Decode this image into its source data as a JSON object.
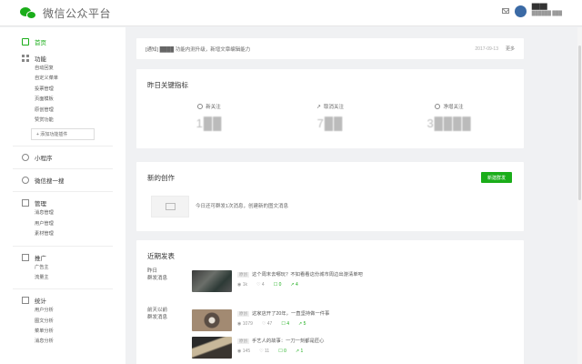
{
  "topbar": {
    "brand": "微信公众平台",
    "user_name": "████",
    "user_sub": "██████ ███"
  },
  "sidebar": {
    "home": "首页",
    "function": "功能",
    "function_items": [
      "自动回复",
      "自定义菜单",
      "投票管理",
      "页面模板",
      "原创管理",
      "赞赏功能"
    ],
    "add_plugin": "+ 添加功能插件",
    "mini_program": "小程序",
    "wechat_search": "微信搜一搜",
    "management": "管理",
    "management_items": [
      "消息管理",
      "用户管理",
      "素材管理"
    ],
    "promote": "推广",
    "promote_items": [
      "广告主",
      "流量主"
    ],
    "stats": "统计",
    "stats_items": [
      "用户分析",
      "图文分析",
      "菜单分析",
      "消息分析"
    ]
  },
  "notice": {
    "text": "[通知] ████ 功能内测升级，新增文章编辑能力",
    "date": "2017-09-13",
    "more": "更多"
  },
  "stats": {
    "title": "昨日关键指标",
    "items": [
      {
        "label": "新关注",
        "value": "1██",
        "icon": "new-follow-icon"
      },
      {
        "label": "取消关注",
        "value": "7██",
        "icon": "unfollow-icon"
      },
      {
        "label": "净增关注",
        "value": "3████",
        "icon": "net-follow-icon"
      }
    ]
  },
  "compose": {
    "title": "新的创作",
    "new_button": "新建群发",
    "hint": "今日还可群发1次消息，创建新的图文消息"
  },
  "recent": {
    "title": "近期发表",
    "groups": [
      {
        "label": [
          "昨日",
          "群发消息"
        ],
        "posts": [
          {
            "tag": "原创",
            "title": "这个周末去哪玩？不如看看这份城市周边出游清单吧",
            "stats": [
              "1k",
              "4",
              "0",
              "4"
            ]
          }
        ]
      },
      {
        "label": [
          "前天以前",
          "群发消息"
        ],
        "posts": [
          {
            "tag": "原创",
            "title": "这家店开了20年，一直坚持做一件事",
            "stats": [
              "1079",
              "47",
              "4",
              "5"
            ]
          },
          {
            "tag": "原创",
            "title": "手艺人的故事：一刀一刻都是匠心",
            "stats": [
              "145",
              "11",
              "0",
              "1"
            ]
          }
        ]
      }
    ]
  },
  "colors": {
    "accent": "#1aad19",
    "background": "#f0f1f3"
  }
}
